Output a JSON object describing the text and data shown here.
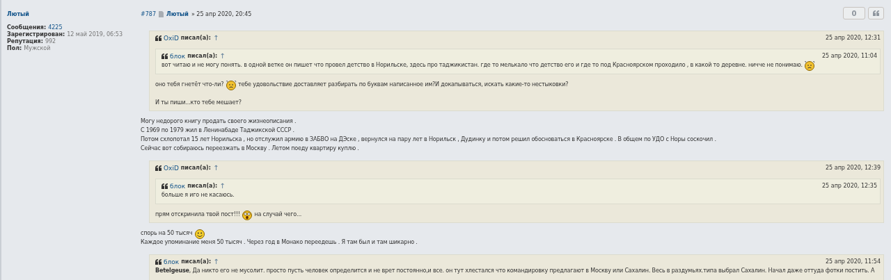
{
  "author": {
    "name": "Лютый",
    "stats": [
      {
        "label": "Сообщения:",
        "value": "4225",
        "kind": "link"
      },
      {
        "label": "Зарегистрирован:",
        "value": "12 май 2019, 06:53",
        "kind": "plain"
      },
      {
        "label": "Репутация:",
        "value": "992",
        "kind": "plain"
      },
      {
        "label": "Пол:",
        "value": "Мужской",
        "kind": "plain"
      }
    ]
  },
  "post": {
    "number": "#787",
    "author": "Лютый",
    "separator": "»",
    "date": "25 апр 2020, 20:45",
    "like_count": "0",
    "blocks": [
      {
        "kind": "quote",
        "author": "OxiD",
        "says": "писал(а):",
        "arrow": "↑",
        "date": "25 апр 2020, 12:31",
        "blocks": [
          {
            "kind": "quote",
            "author": "блок",
            "says": "писал(а):",
            "arrow": "↑",
            "date": "25 апр 2020, 11:04",
            "blocks": [
              {
                "kind": "para",
                "lines": [
                  [
                    {
                      "kind": "text",
                      "text": "вот читаю и не могу понять. в одной ветке он пишет что провел детство в Норильске, здесь про таджикистан. где то мелькало что детство его и где то под Красноярском проходило , в какой то деревне. ничче не понимаю. "
                    },
                    {
                      "kind": "puzzled"
                    }
                  ]
                ]
              }
            ]
          },
          {
            "kind": "para",
            "lines": [
              [
                {
                  "kind": "text",
                  "text": "оно тебя гнетёт что-ли? "
                },
                {
                  "kind": "puzzled"
                },
                {
                  "kind": "text",
                  "text": " тебе удовольствие доставляет разбирать по буквам написанное им?И докапываться, искать какие-то нестыковки?"
                }
              ]
            ]
          },
          {
            "kind": "para",
            "lines": [
              [
                {
                  "kind": "text",
                  "text": "И ты пиши...кто тебе мешает?"
                }
              ]
            ]
          }
        ]
      },
      {
        "kind": "para",
        "lines": [
          [
            {
              "kind": "text",
              "text": "Могу недорого книгу продать своего жизнеописания ."
            }
          ],
          [
            {
              "kind": "text",
              "text": "С 1969 по 1979 жил в Ленинабаде Таджикской СССР ."
            }
          ],
          [
            {
              "kind": "text",
              "text": "Потом схлопотал 15 лет Норильска , но отслужил армию в ЗАБВО на ДЭске , вернулся на пару лет в Норильск , Дудинку и потом решил обосноваться в Красноярске . В общем по УДО с Норы соскочил ."
            }
          ],
          [
            {
              "kind": "text",
              "text": "Сейчас вот собираюсь переезжать в Москву . Летом поеду квартиру куплю ."
            }
          ]
        ]
      },
      {
        "kind": "quote",
        "author": "OxiD",
        "says": "писал(а):",
        "arrow": "↑",
        "date": "25 апр 2020, 12:39",
        "blocks": [
          {
            "kind": "quote",
            "author": "блок",
            "says": "писал(а):",
            "arrow": "↑",
            "date": "25 апр 2020, 12:35",
            "blocks": [
              {
                "kind": "para",
                "lines": [
                  [
                    {
                      "kind": "text",
                      "text": "больше я иго не касаюсь."
                    }
                  ]
                ]
              }
            ]
          },
          {
            "kind": "para",
            "lines": [
              [
                {
                  "kind": "text",
                  "text": "прям отскринила твой пост!!! "
                },
                {
                  "kind": "shocked"
                },
                {
                  "kind": "text",
                  "text": " на случай чего..."
                }
              ]
            ]
          }
        ]
      },
      {
        "kind": "para",
        "lines": [
          [
            {
              "kind": "text",
              "text": "спорь на 50 тысяч "
            },
            {
              "kind": "happy"
            }
          ],
          [
            {
              "kind": "text",
              "text": "Каждое упоминание меня 50 тысяч . Через год в Монако переедешь . Я там был и там шикарно ."
            }
          ]
        ]
      },
      {
        "kind": "quote",
        "author": "блок",
        "says": "писал(а):",
        "arrow": "↑",
        "date": "25 апр 2020, 11:54",
        "blocks": [
          {
            "kind": "para",
            "lines": [
              [
                {
                  "kind": "text",
                  "text": "**Betelgeuse**, Да никто его не мусолит. просто пусть человек определится и не врет постоянно,и все. он тут хлестался что командировку предлагают в Москву или Сахалин. Весь в раздумьях.типа выбрал Сахалин. Начал даже оттуда фотки постить. А"
                }
              ]
            ]
          }
        ]
      }
    ]
  }
}
